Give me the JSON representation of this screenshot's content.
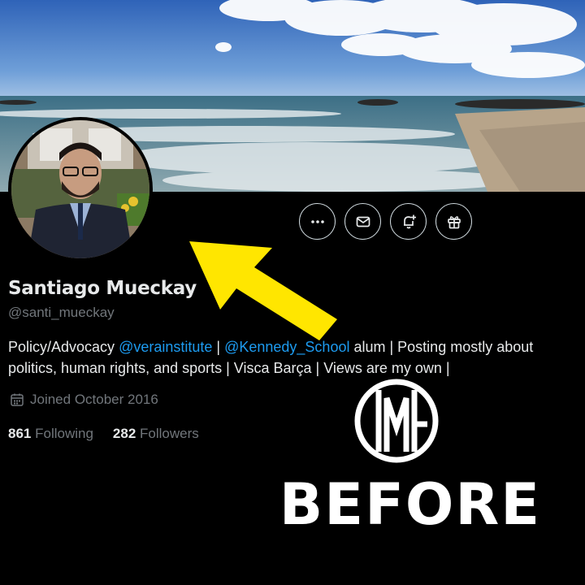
{
  "profile": {
    "name": "Santiago Mueckay",
    "handle": "@santi_mueckay",
    "bio": {
      "part1": "Policy/Advocacy ",
      "mention1": "@verainstitute",
      "part2": " | ",
      "mention2": "@Kennedy_School",
      "part3": " alum | Posting mostly about politics, human rights, and sports | Visca Barça | Views are my own |"
    },
    "joined": "Joined October 2016",
    "following_count": "861",
    "following_label": "Following",
    "followers_count": "282",
    "followers_label": "Followers"
  },
  "actions": [
    {
      "icon": "more-icon"
    },
    {
      "icon": "message-icon"
    },
    {
      "icon": "notify-bell-icon"
    },
    {
      "icon": "gift-icon"
    }
  ],
  "overlay": {
    "text": "BEFORE",
    "arrow_color": "#FFE600"
  },
  "colors": {
    "background": "#000000",
    "link": "#1d9bf0",
    "secondary_text": "#71767b",
    "primary_text": "#e7e9ea"
  }
}
